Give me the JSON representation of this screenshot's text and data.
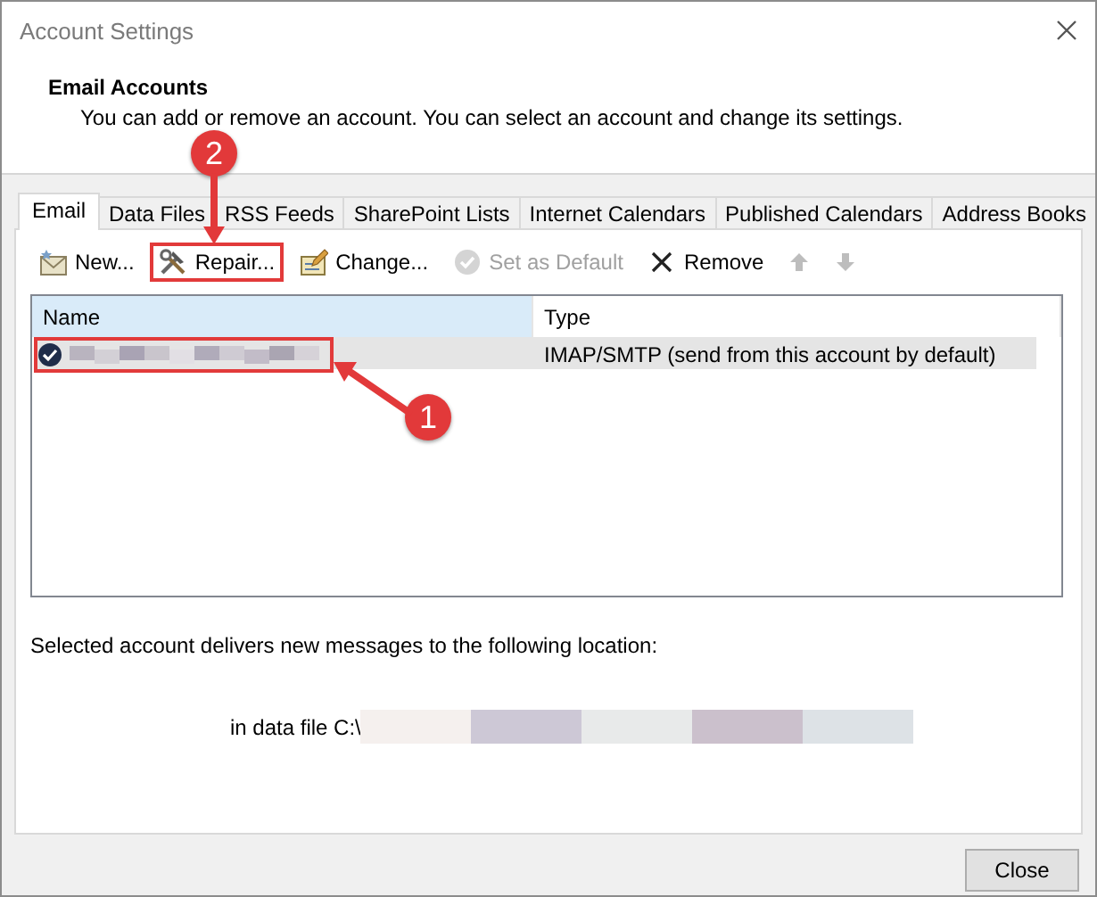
{
  "window": {
    "title": "Account Settings"
  },
  "header": {
    "title": "Email Accounts",
    "description": "You can add or remove an account. You can select an account and change its settings."
  },
  "tabs": [
    {
      "label": "Email",
      "selected": true
    },
    {
      "label": "Data Files",
      "selected": false
    },
    {
      "label": "RSS Feeds",
      "selected": false
    },
    {
      "label": "SharePoint Lists",
      "selected": false
    },
    {
      "label": "Internet Calendars",
      "selected": false
    },
    {
      "label": "Published Calendars",
      "selected": false
    },
    {
      "label": "Address Books",
      "selected": false
    }
  ],
  "toolbar": [
    {
      "kind": "new",
      "label": "New...",
      "disabled": false,
      "highlighted": false
    },
    {
      "kind": "repair",
      "label": "Repair...",
      "disabled": false,
      "highlighted": true
    },
    {
      "kind": "change",
      "label": "Change...",
      "disabled": false,
      "highlighted": false
    },
    {
      "kind": "default",
      "label": "Set as Default",
      "disabled": true,
      "highlighted": false
    },
    {
      "kind": "remove",
      "label": "Remove",
      "disabled": false,
      "highlighted": false
    },
    {
      "kind": "up",
      "disabled": true,
      "highlighted": false
    },
    {
      "kind": "down",
      "disabled": true,
      "highlighted": false
    }
  ],
  "accounts": {
    "columns": [
      "Name",
      "Type"
    ],
    "rows": [
      {
        "type": "IMAP/SMTP (send from this account by default)",
        "selected": true,
        "highlighted": true
      }
    ]
  },
  "footer": {
    "text": "Selected account delivers new messages to the following location:",
    "location": "in data file C:\\"
  },
  "buttons": [
    "Close"
  ],
  "annotations": [
    {
      "number": "2",
      "kind": "toolbar"
    },
    {
      "number": "1",
      "kind": "accounts"
    }
  ]
}
